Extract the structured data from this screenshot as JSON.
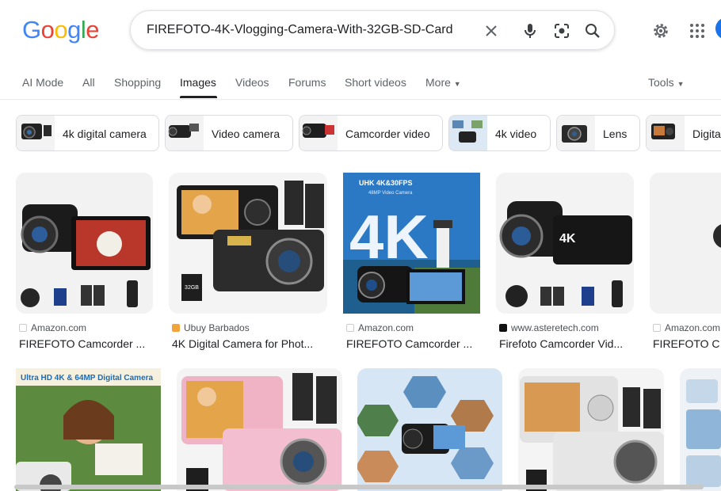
{
  "header": {
    "logo": "Google",
    "query": "FIREFOTO-4K-Vlogging-Camera-With-32GB-SD-Card",
    "icons": [
      "clear-icon",
      "mic-icon",
      "lens-icon",
      "search-icon",
      "settings-icon",
      "apps-icon"
    ]
  },
  "tabs": [
    "AI Mode",
    "All",
    "Shopping",
    "Images",
    "Videos",
    "Forums",
    "Short videos",
    "More"
  ],
  "active_tab": "Images",
  "tools_label": "Tools",
  "chips": [
    "4k digital camera",
    "Video camera",
    "Camcorder video",
    "4k video",
    "Lens",
    "Digita"
  ],
  "results_row1": [
    {
      "source": "Amazon.com",
      "title": "FIREFOTO Camcorder ..."
    },
    {
      "source": "Ubuy Barbados",
      "title": "4K Digital Camera for Phot..."
    },
    {
      "source": "Amazon.com",
      "title": "FIREFOTO Camcorder ..."
    },
    {
      "source": "www.asteretech.com",
      "title": "Firefoto Camcorder Vid..."
    },
    {
      "source": "Amazon.com",
      "title": "FIREFOTO C"
    }
  ],
  "image_texts": {
    "uhk": "UHK 4K&30FPS",
    "uhk_sub": "48MP Video Camera",
    "big4k": "4K",
    "ultrahd": "Ultra HD 4K & 64MP Digital Camera",
    "badge4k": "4K",
    "sd": "32GB"
  },
  "colors": {
    "accent": "#1a73e8",
    "logo_blue": "#4285f4",
    "logo_red": "#ea4335",
    "logo_yellow": "#fbbc05",
    "logo_green": "#34a853"
  }
}
